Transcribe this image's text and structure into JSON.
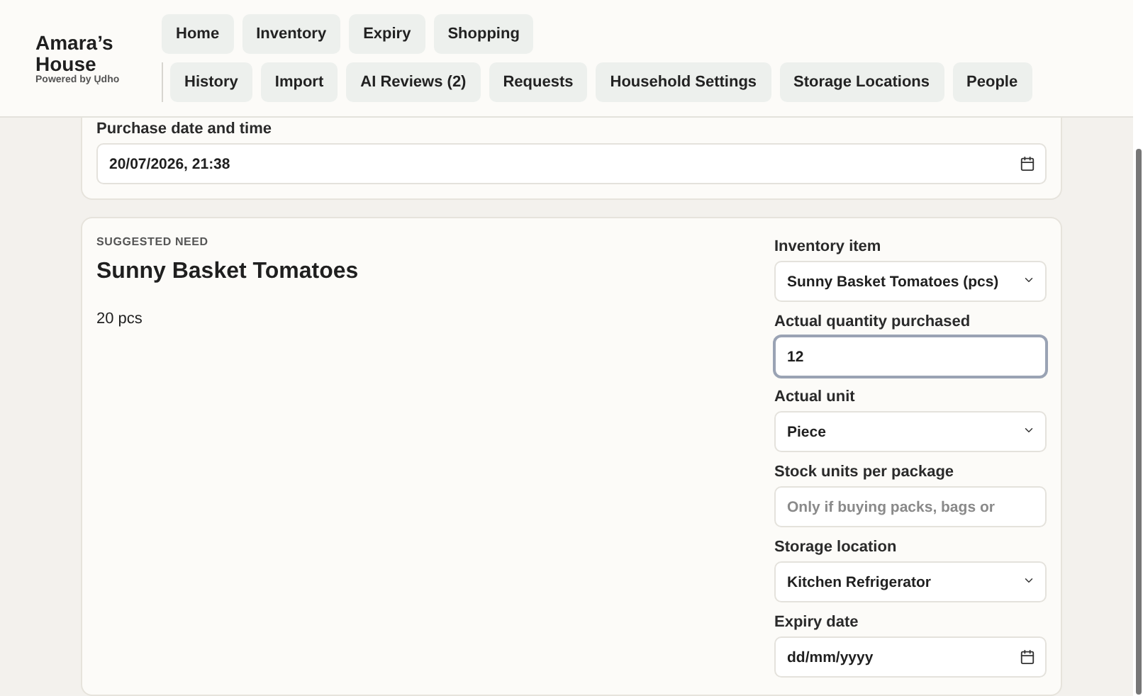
{
  "brand": {
    "name": "Amara’s House",
    "tagline": "Powered by Ųdho"
  },
  "nav": {
    "primary": [
      "Home",
      "Inventory",
      "Expiry",
      "Shopping"
    ],
    "secondary": [
      "History",
      "Import",
      "AI Reviews (2)",
      "Requests",
      "Household Settings",
      "Storage Locations",
      "People"
    ]
  },
  "purchase": {
    "label": "Purchase date and time",
    "value": "20/07/2026, 21:38"
  },
  "need": {
    "eyebrow": "SUGGESTED NEED",
    "title": "Sunny Basket Tomatoes",
    "amount": "20 pcs",
    "fields": [
      {
        "kind": "select",
        "label": "Inventory item",
        "value": "Sunny Basket Tomatoes (pcs)"
      },
      {
        "kind": "input",
        "label": "Actual quantity purchased",
        "value": "12",
        "focused": true
      },
      {
        "kind": "select",
        "label": "Actual unit",
        "value": "Piece"
      },
      {
        "kind": "input",
        "label": "Stock units per package",
        "placeholder": "Only if buying packs, bags or",
        "focused": false
      },
      {
        "kind": "select",
        "label": "Storage location",
        "value": "Kitchen Refrigerator"
      },
      {
        "kind": "date",
        "label": "Expiry date",
        "value": "dd/mm/yyyy"
      }
    ]
  }
}
